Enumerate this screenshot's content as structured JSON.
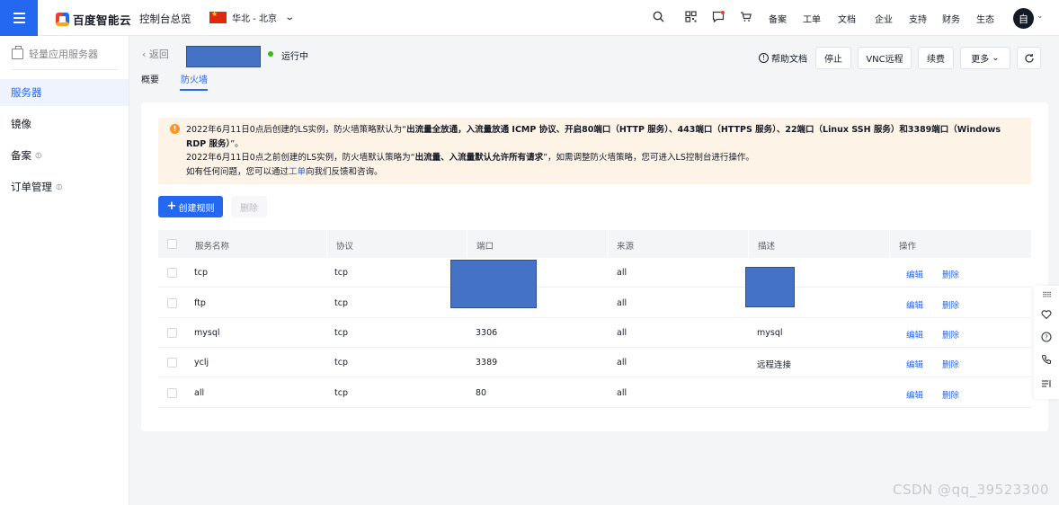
{
  "topbar": {
    "brand": "百度智能云",
    "console_home": "控制台总览",
    "region": "华北 - 北京",
    "links": [
      "备案",
      "工单",
      "文档",
      "企业",
      "支持",
      "财务",
      "生态"
    ],
    "avatar_text": "自"
  },
  "sidebar": {
    "title": "轻量应用服务器",
    "items": [
      {
        "label": "服务器",
        "active": true
      },
      {
        "label": "镜像"
      },
      {
        "label": "备案"
      },
      {
        "label": "订单管理"
      }
    ]
  },
  "header": {
    "back_label": "返回",
    "status": "运行中",
    "tabs": [
      "概要",
      "防火墙"
    ],
    "active_tab": "防火墙",
    "buttons": {
      "help": "帮助文档",
      "stop": "停止",
      "vnc": "VNC远程",
      "renew": "续费",
      "more": "更多"
    }
  },
  "notice": {
    "line1_prefix": "2022年6月11日0点后创建的LS实例，防火墙策略默认为“",
    "line1_bold": "出流量全放通，入流量放通 ICMP 协议、开启80端口（HTTP 服务）、443端口（HTTPS 服务）、22端口（Linux SSH 服务）和3389端口（Windows RDP 服务）",
    "line1_suffix": "”。",
    "line2_prefix": "2022年6月11日0点之前创建的LS实例，防火墙默认策略为“",
    "line2_bold": "出流量、入流量默认允许所有请求",
    "line2_suffix": "”，如需调整防火墙策略，您可进入LS控制台进行操作。",
    "line3_prefix": "如有任何问题，您可以通过",
    "line3_link": "工单",
    "line3_suffix": "向我们反馈和咨询。"
  },
  "actions": {
    "create": "创建规则",
    "delete": "删除"
  },
  "table": {
    "columns": [
      "服务名称",
      "协议",
      "端口",
      "来源",
      "描述",
      "操作"
    ],
    "rows": [
      {
        "name": "tcp",
        "protocol": "tcp",
        "port": "",
        "source": "all",
        "desc": ""
      },
      {
        "name": "ftp",
        "protocol": "tcp",
        "port": "",
        "source": "all",
        "desc": ""
      },
      {
        "name": "mysql",
        "protocol": "tcp",
        "port": "3306",
        "source": "all",
        "desc": "mysql"
      },
      {
        "name": "yclj",
        "protocol": "tcp",
        "port": "3389",
        "source": "all",
        "desc": "远程连接"
      },
      {
        "name": "all",
        "protocol": "tcp",
        "port": "80",
        "source": "all",
        "desc": ""
      }
    ],
    "op_edit": "编辑",
    "op_delete": "删除"
  },
  "watermark": "CSDN @qq_39523300",
  "colors": {
    "accent": "#2468f2",
    "running": "#30bf13",
    "warning": "#ff9326",
    "redaction": "#4472c4"
  }
}
